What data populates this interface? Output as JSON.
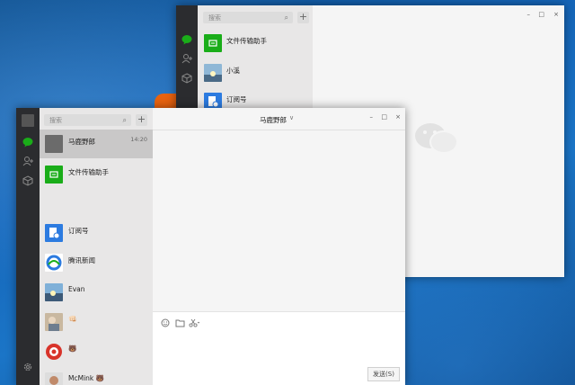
{
  "back_window": {
    "search_placeholder": "搜索",
    "add_label": "+",
    "chats": [
      {
        "name": "文件传输助手",
        "avatar": "file-transfer-icon"
      },
      {
        "name": "小溪",
        "avatar": "photo-avatar"
      },
      {
        "name": "订阅号",
        "avatar": "subscription-icon"
      }
    ],
    "controls": {
      "minimize": "–",
      "maximize": "□",
      "close": "×"
    }
  },
  "front_window": {
    "search_placeholder": "搜索",
    "add_label": "+",
    "title": "马鹿野郎",
    "chats": [
      {
        "name": "马鹿野郎",
        "time": "14:20",
        "selected": true
      },
      {
        "name": "文件传输助手"
      },
      {
        "name": "订阅号"
      },
      {
        "name": "腾讯新闻"
      },
      {
        "name": "Evan"
      },
      {
        "name": "👊🏻"
      },
      {
        "name": "🐻"
      },
      {
        "name": "McMink 🐻"
      }
    ],
    "toolbar_icons": [
      "emoji-icon",
      "folder-icon",
      "scissors-icon"
    ],
    "send_button": "发送(S)",
    "controls": {
      "minimize": "–",
      "maximize": "□",
      "close": "×"
    }
  },
  "colors": {
    "wechat_green": "#1aad19",
    "sidebar": "#2b2c2f",
    "list_bg": "#e8e7e7",
    "selected": "#c9c8c8"
  }
}
